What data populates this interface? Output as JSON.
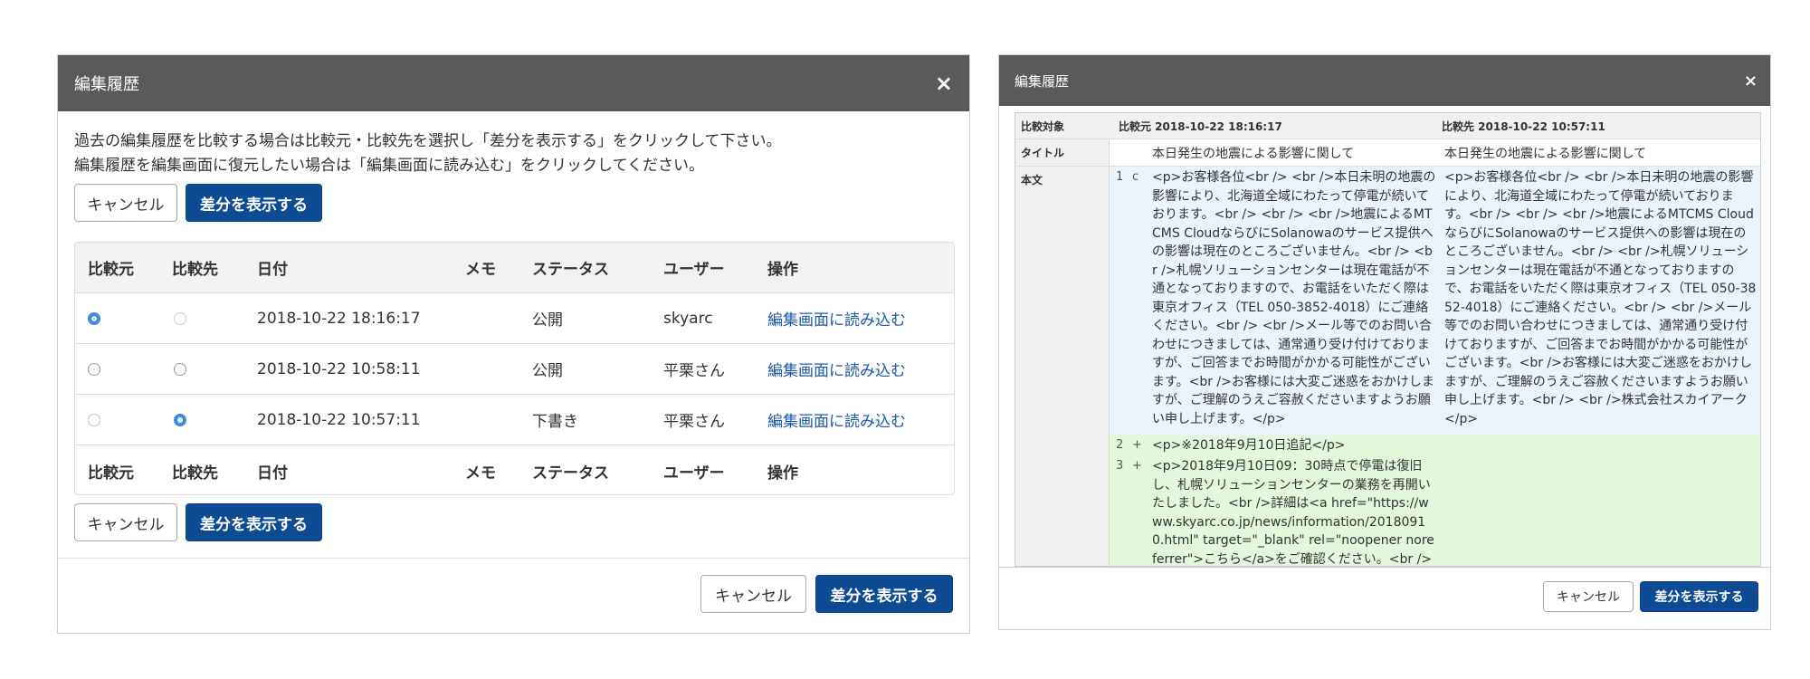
{
  "left_dialog": {
    "title": "編集履歴",
    "close_label": "×",
    "instructions": [
      "過去の編集履歴を比較する場合は比較元・比較先を選択し「差分を表示する」をクリックして下さい。",
      "編集履歴を編集画面に復元したい場合は「編集画面に読み込む」をクリックしてください。"
    ],
    "cancel_label": "キャンセル",
    "show_diff_label": "差分を表示する",
    "columns": [
      "比較元",
      "比較先",
      "日付",
      "メモ",
      "ステータス",
      "ユーザー",
      "操作"
    ],
    "rows": [
      {
        "date": "2018-10-22 18:16:17",
        "memo": "",
        "status": "公開",
        "user": "skyarc",
        "action": "編集画面に読み込む",
        "source": "checked",
        "target": "disabled"
      },
      {
        "date": "2018-10-22 10:58:11",
        "memo": "",
        "status": "公開",
        "user": "平栗さん",
        "action": "編集画面に読み込む",
        "source": "unchecked",
        "target": "unchecked"
      },
      {
        "date": "2018-10-22 10:57:11",
        "memo": "",
        "status": "下書き",
        "user": "平栗さん",
        "action": "編集画面に読み込む",
        "source": "disabled",
        "target": "checked"
      }
    ]
  },
  "right_dialog": {
    "title": "編集履歴",
    "close_label": "×",
    "header": {
      "label": "比較対象",
      "source": "比較元 2018-10-22 18:16:17",
      "target": "比較先 2018-10-22 10:57:11"
    },
    "title_row": {
      "label": "タイトル",
      "source": "本日発生の地震による影響に関して",
      "target": "本日発生の地震による影響に関して"
    },
    "body_row": {
      "label": "本文",
      "lines": [
        {
          "num": "1",
          "mark": "c",
          "source": "<p>お客様各位<br /> <br />本日未明の地震の影響により、北海道全域にわたって停電が続いております。<br /> <br /> <br />地震によるMTCMS CloudならびにSolanowaのサービス提供への影響は現在のところございません。<br /> <br />札幌ソリューションセンターは現在電話が不通となっておりますので、お電話をいただく際は東京オフィス（TEL 050-3852-4018）にご連絡ください。<br /> <br />メール等でのお問い合わせにつきましては、通常通り受け付けておりますが、ご回答までお時間がかかる可能性がございます。<br />お客様には大変ご迷惑をおかけしますが、ご理解のうえご容赦くださいますようお願い申し上げます。</p>",
          "target": "<p>お客様各位<br /> <br />本日未明の地震の影響により、北海道全域にわたって停電が続いております。<br /> <br /> <br />地震によるMTCMS CloudならびにSolanowaのサービス提供への影響は現在のところございません。<br /> <br />札幌ソリューションセンターは現在電話が不通となっておりますので、お電話をいただく際は東京オフィス（TEL 050-3852-4018）にご連絡ください。<br /> <br />メール等でのお問い合わせにつきましては、通常通り受け付けておりますが、ご回答までお時間がかかる可能性がございます。<br />お客様には大変ご迷惑をおかけしますが、ご理解のうえご容赦くださいますようお願い申し上げます。<br /> <br />株式会社スカイアーク</p>"
        },
        {
          "num": "2",
          "mark": "+",
          "source": "<p>※2018年9月10日追記</p>"
        },
        {
          "num": "3",
          "mark": "+",
          "source": "<p>2018年9月10日09：30時点で停電は復旧し、札幌ソリューションセンターの業務を再開いたしました。<br />詳細は<a href=\"https://www.skyarc.co.jp/news/information/20180910.html\" target=\"_blank\" rel=\"noopener noreferrer\">こちら</a>をご確認ください。<br /> <"
        }
      ]
    },
    "cancel_label": "キャンセル",
    "show_diff_label": "差分を表示する"
  }
}
